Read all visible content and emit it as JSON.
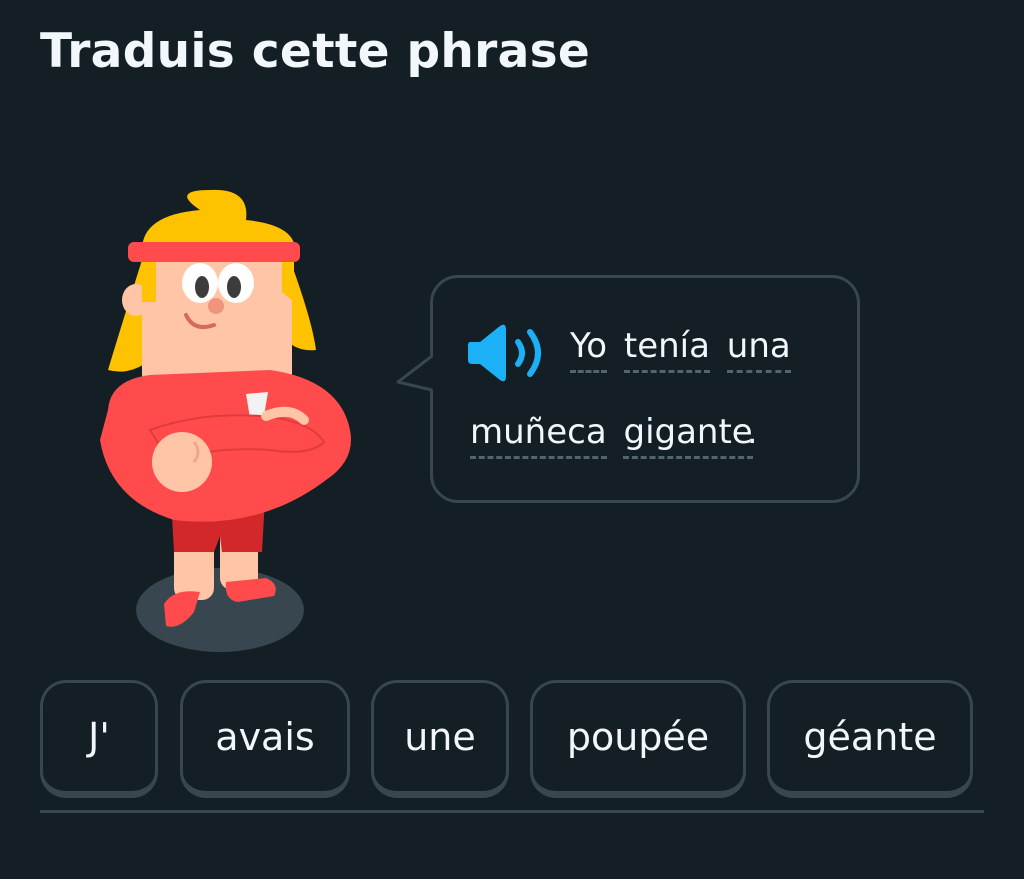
{
  "header": {
    "title": "Traduis cette phrase"
  },
  "prompt": {
    "speaker_icon": "speaker-icon",
    "line1": [
      "Yo",
      "tenía",
      "una"
    ],
    "line2": [
      "muñeca",
      "gigante"
    ],
    "punctuation": "."
  },
  "word_bank": [
    "J'",
    "avais",
    "une",
    "poupée",
    "géante"
  ],
  "colors": {
    "background": "#131f24",
    "border": "#37464f",
    "text": "#f1f7fb",
    "speaker": "#1cb0f6"
  }
}
